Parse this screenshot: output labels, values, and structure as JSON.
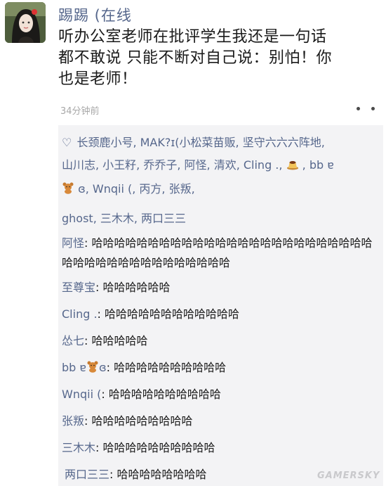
{
  "post": {
    "username": "踢踢 (在线",
    "text": "听办公室老师在批评学生我还是一句话都不敢说 只能不断对自己说：别怕！你也是老师！",
    "timestamp": "34分钟前"
  },
  "likes": {
    "line1": "长颈鹿小号, MAK?ɪ(小松菜苗贩, 坚守六六六阵地, 山川志, 小王籽, 乔乔子, 阿怪, 清欢, Cling ., ",
    "line2": ", bb ɐ",
    "line3": "ɞ, Wnqii (, 丙方, 张叛,",
    "line4": "ghost, 三木木, 两口三三"
  },
  "comments": [
    {
      "author": "阿怪",
      "text": "哈哈哈哈哈哈哈哈哈哈哈哈哈哈哈哈哈哈哈哈哈哈哈哈哈哈哈哈哈哈哈哈哈哈哈哈哈哈哈哈"
    },
    {
      "author": "至尊宝",
      "text": "哈哈哈哈哈哈"
    },
    {
      "author": "Cling .",
      "text": "哈哈哈哈哈哈哈哈哈哈哈哈"
    },
    {
      "author": "怂七",
      "text": "哈哈哈哈哈"
    },
    {
      "author_pre": "bb ɐ",
      "author_post": "ɞ",
      "text": "哈哈哈哈哈哈哈哈哈哈"
    },
    {
      "author": "Wnqii (",
      "text": "哈哈哈哈哈哈哈哈哈哈"
    },
    {
      "author": "张叛",
      "text": "哈哈哈哈哈哈哈哈哈"
    },
    {
      "author": "三木木",
      "text": "哈哈哈哈哈哈哈哈哈哈"
    },
    {
      "author": "两口三三",
      "text": "哈哈哈哈哈哈哈哈"
    }
  ],
  "watermark": "GAMERSKY",
  "colors": {
    "name": "#56678c",
    "comment_bg": "#f3f3f5",
    "timestamp": "#a8a8a8"
  },
  "icons": [
    "heart-outline-icon",
    "more-dots-icon",
    "pudding-emoji",
    "bear-emoji"
  ]
}
